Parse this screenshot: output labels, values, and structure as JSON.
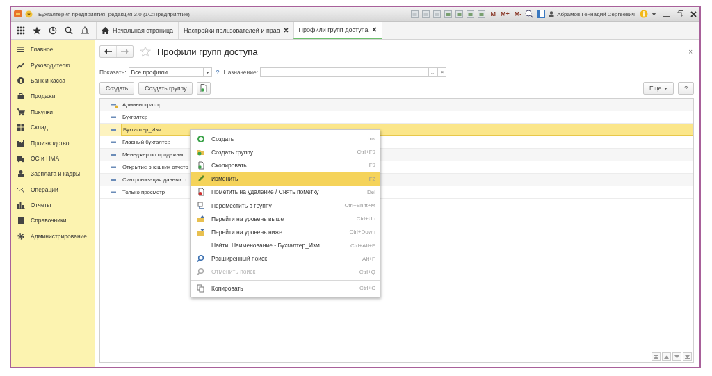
{
  "window": {
    "title": "Бухгалтерия предприятия, редакция 3.0 (1С:Предприятие)",
    "memory_buttons": [
      "M",
      "M+",
      "M-"
    ],
    "user": "Абрамов Геннадий Сергеевич"
  },
  "tabs": [
    {
      "label": "Начальная страница",
      "home": true,
      "closable": false,
      "selected": false
    },
    {
      "label": "Настройки пользователей и прав",
      "home": false,
      "closable": true,
      "selected": false
    },
    {
      "label": "Профили групп доступа",
      "home": false,
      "closable": true,
      "selected": true
    }
  ],
  "sidebar": {
    "items": [
      {
        "label": "Главное"
      },
      {
        "label": "Руководителю"
      },
      {
        "label": "Банк и касса"
      },
      {
        "label": "Продажи"
      },
      {
        "label": "Покупки"
      },
      {
        "label": "Склад"
      },
      {
        "label": "Производство"
      },
      {
        "label": "ОС и НМА"
      },
      {
        "label": "Зарплата и кадры"
      },
      {
        "label": "Операции"
      },
      {
        "label": "Отчеты"
      },
      {
        "label": "Справочники"
      },
      {
        "label": "Администрирование"
      }
    ]
  },
  "form": {
    "title": "Профили групп доступа",
    "close": "×",
    "filters": {
      "show_label": "Показать:",
      "show_value": "Все профили",
      "help": "?",
      "purpose_label": "Назначение:",
      "purpose_select": "...",
      "purpose_clear": "×"
    },
    "buttons": [
      "Создать",
      "Создать группу"
    ],
    "more": "Еще",
    "help": "?"
  },
  "table": {
    "rows": [
      {
        "name": "Администратор",
        "selected": false
      },
      {
        "name": "Бухгалтер",
        "selected": false
      },
      {
        "name": "Бухгалтер_Изм",
        "selected": true
      },
      {
        "name": "Главный бухгалтер",
        "selected": false
      },
      {
        "name": "Менеджер по продажам",
        "selected": false
      },
      {
        "name": "Открытие внешних отчето",
        "selected": false
      },
      {
        "name": "Синхронизация данных с",
        "selected": false
      },
      {
        "name": "Только просмотр",
        "selected": false
      }
    ]
  },
  "context_menu": {
    "items": [
      {
        "label": "Создать",
        "shortcut": "Ins",
        "selected": false,
        "disabled": false,
        "divider": false
      },
      {
        "label": "Создать группу",
        "shortcut": "Ctrl+F9",
        "selected": false,
        "disabled": false,
        "divider": false
      },
      {
        "label": "Скопировать",
        "shortcut": "F9",
        "selected": false,
        "disabled": false,
        "divider": false
      },
      {
        "label": "Изменить",
        "shortcut": "F2",
        "selected": true,
        "disabled": false,
        "divider": false
      },
      {
        "label": "Пометить на удаление / Снять пометку",
        "shortcut": "Del",
        "selected": false,
        "disabled": false,
        "divider": false
      },
      {
        "label": "Переместить в группу",
        "shortcut": "Ctrl+Shift+M",
        "selected": false,
        "disabled": false,
        "divider": false
      },
      {
        "label": "Перейти на уровень выше",
        "shortcut": "Ctrl+Up",
        "selected": false,
        "disabled": false,
        "divider": false
      },
      {
        "label": "Перейти на уровень ниже",
        "shortcut": "Ctrl+Down",
        "selected": false,
        "disabled": false,
        "divider": false
      },
      {
        "label": "Найти: Наименование - Бухгалтер_Изм",
        "shortcut": "Ctrl+Alt+F",
        "selected": false,
        "disabled": false,
        "divider": false
      },
      {
        "label": "Расширенный поиск",
        "shortcut": "Alt+F",
        "selected": false,
        "disabled": false,
        "divider": false
      },
      {
        "label": "Отменить поиск",
        "shortcut": "Ctrl+Q",
        "selected": false,
        "disabled": true,
        "divider": false
      },
      {
        "label": "Копировать",
        "shortcut": "Ctrl+C",
        "selected": false,
        "disabled": false,
        "divider": true
      }
    ]
  }
}
